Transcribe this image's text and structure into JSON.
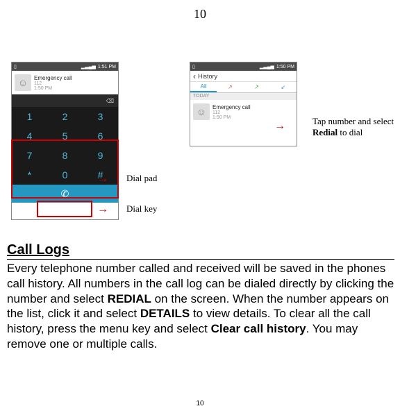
{
  "page_number_top": "10",
  "page_number_bottom": "10",
  "phone1": {
    "time": "1:51 PM",
    "signal": "▂▃▄▅",
    "contact_name": "Emergency call",
    "contact_number": "112",
    "contact_time": "1:50 PM",
    "backspace": "⌫",
    "keys": {
      "r1c1": "1",
      "r1c2": "2",
      "r1c3": "3",
      "r2c1": "4",
      "r2c2": "5",
      "r2c3": "6",
      "r3c1": "7",
      "r3c2": "8",
      "r3c3": "9",
      "r4c1": "*",
      "r4c2": "0",
      "r4c3": "#"
    },
    "dial_icon": "✆"
  },
  "labels": {
    "dial_pad": "Dial pad",
    "dial_key": "Dial key",
    "redial": "Tap number and select ",
    "redial_bold": "Redial",
    "redial_after": " to dial"
  },
  "phone2": {
    "time": "1:50 PM",
    "signal": "▂▃▄▅",
    "back": "‹",
    "title": "History",
    "tab_all": "All",
    "tab_missed": "↗",
    "tab_out": "↗",
    "tab_in": "↙",
    "today": "TODAY",
    "contact_name": "Emergency call",
    "contact_number": "112",
    "contact_time": "1:50 PM"
  },
  "section": {
    "heading": "Call Logs",
    "para_1": "Every telephone number called and received will be saved in the phones call history. All numbers in the call log can be dialed directly by clicking the number and select ",
    "para_redial": "REDIAL",
    "para_2": " on the screen. When the number appears on the list, click it and select ",
    "para_details": "DETAILS",
    "para_3": " to view details. To clear all the call history, press the menu key and select ",
    "para_clear": "Clear call history",
    "para_4": ". You may remove one or multiple calls."
  }
}
